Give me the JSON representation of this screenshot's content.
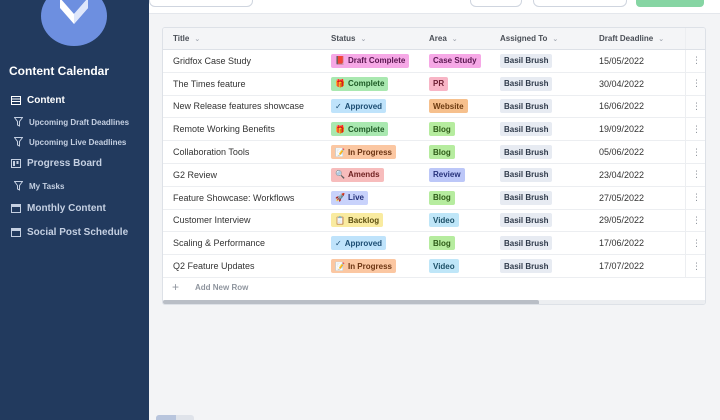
{
  "sidebar": {
    "title": "Content Calendar",
    "items": [
      {
        "label": "Content",
        "icon": "table-icon",
        "active": true
      },
      {
        "label": "Upcoming Draft Deadlines",
        "icon": "filter-icon"
      },
      {
        "label": "Upcoming Live Deadlines",
        "icon": "filter-icon"
      },
      {
        "label": "Progress Board",
        "icon": "board-icon"
      },
      {
        "label": "My Tasks",
        "icon": "filter-icon"
      },
      {
        "label": "Monthly Content",
        "icon": "calendar-icon"
      },
      {
        "label": "Social Post Schedule",
        "icon": "calendar-icon"
      }
    ]
  },
  "table": {
    "columns": [
      "Title",
      "Status",
      "Area",
      "Assigned To",
      "Draft Deadline"
    ],
    "rows": [
      {
        "title": "Gridfox Case Study",
        "status": "Draft Complete",
        "area": "Case Study",
        "assigned": "Basil Brush",
        "deadline": "15/05/2022"
      },
      {
        "title": "The Times feature",
        "status": "Complete",
        "area": "PR",
        "assigned": "Basil Brush",
        "deadline": "30/04/2022"
      },
      {
        "title": "New Release features showcase",
        "status": "Approved",
        "area": "Website",
        "assigned": "Basil Brush",
        "deadline": "16/06/2022"
      },
      {
        "title": "Remote Working Benefits",
        "status": "Complete",
        "area": "Blog",
        "assigned": "Basil Brush",
        "deadline": "19/09/2022"
      },
      {
        "title": "Collaboration Tools",
        "status": "In Progress",
        "area": "Blog",
        "assigned": "Basil Brush",
        "deadline": "05/06/2022"
      },
      {
        "title": "G2 Review",
        "status": "Amends",
        "area": "Review",
        "assigned": "Basil Brush",
        "deadline": "23/04/2022"
      },
      {
        "title": "Feature Showcase: Workflows",
        "status": "Live",
        "area": "Blog",
        "assigned": "Basil Brush",
        "deadline": "27/05/2022"
      },
      {
        "title": "Customer Interview",
        "status": "Backlog",
        "area": "Video",
        "assigned": "Basil Brush",
        "deadline": "29/05/2022"
      },
      {
        "title": "Scaling & Performance",
        "status": "Approved",
        "area": "Blog",
        "assigned": "Basil Brush",
        "deadline": "17/06/2022"
      },
      {
        "title": "Q2 Feature Updates",
        "status": "In Progress",
        "area": "Video",
        "assigned": "Basil Brush",
        "deadline": "17/07/2022"
      }
    ],
    "add_row_label": "Add New Row"
  },
  "status_styles": {
    "Draft Complete": {
      "bg": "#f6a8e6",
      "fg": "#5a1650",
      "glyph": "📕"
    },
    "Complete": {
      "bg": "#a9e8b0",
      "fg": "#1e5a26",
      "glyph": "🎁"
    },
    "Approved": {
      "bg": "#bfe3fb",
      "fg": "#1b4c72",
      "glyph": "✓"
    },
    "In Progress": {
      "bg": "#fbc7a2",
      "fg": "#6b3412",
      "glyph": "📝"
    },
    "Amends": {
      "bg": "#f7bcbc",
      "fg": "#6e1f1f",
      "glyph": "🔍"
    },
    "Live": {
      "bg": "#c8d2fb",
      "fg": "#23307a",
      "glyph": "🚀"
    },
    "Backlog": {
      "bg": "#f9eba0",
      "fg": "#5e5010",
      "glyph": "📋"
    }
  },
  "area_styles": {
    "Case Study": {
      "bg": "#f6a8e6",
      "fg": "#5a1650"
    },
    "PR": {
      "bg": "#f8b5c6",
      "fg": "#6b1c30"
    },
    "Website": {
      "bg": "#f6c08d",
      "fg": "#6b3a10"
    },
    "Blog": {
      "bg": "#b6ec9f",
      "fg": "#2d5a17"
    },
    "Review": {
      "bg": "#bcc7f8",
      "fg": "#26317a"
    },
    "Video": {
      "bg": "#bfe6f8",
      "fg": "#1b4f66"
    }
  },
  "assigned_style": {
    "bg": "#e7ebf2",
    "fg": "#2f3a4a"
  }
}
